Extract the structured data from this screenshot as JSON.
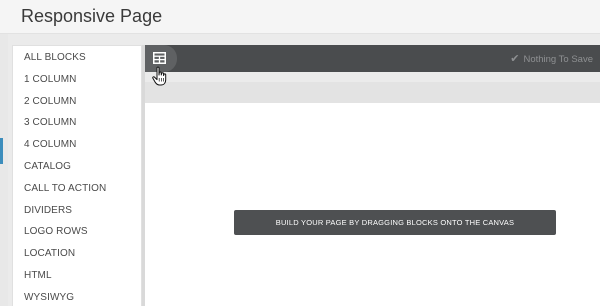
{
  "header": {
    "title": "Responsive Page"
  },
  "sidebar": {
    "items": [
      {
        "label": "ALL BLOCKS"
      },
      {
        "label": "1 COLUMN"
      },
      {
        "label": "2 COLUMN"
      },
      {
        "label": "3 COLUMN"
      },
      {
        "label": "4 COLUMN"
      },
      {
        "label": "CATALOG"
      },
      {
        "label": "CALL TO ACTION"
      },
      {
        "label": "DIVIDERS"
      },
      {
        "label": "LOGO ROWS"
      },
      {
        "label": "LOCATION"
      },
      {
        "label": "HTML"
      },
      {
        "label": "WYSIWYG"
      }
    ]
  },
  "toolbar": {
    "grid_icon": "grid-layout-icon",
    "save_status": "Nothing To Save",
    "save_icon": "checkmark-icon"
  },
  "canvas": {
    "message": "BUILD YOUR PAGE BY DRAGGING BLOCKS ONTO THE CANVAS"
  },
  "colors": {
    "toolbar_bg": "#4a4c4e",
    "accent": "#3c8dbc"
  }
}
